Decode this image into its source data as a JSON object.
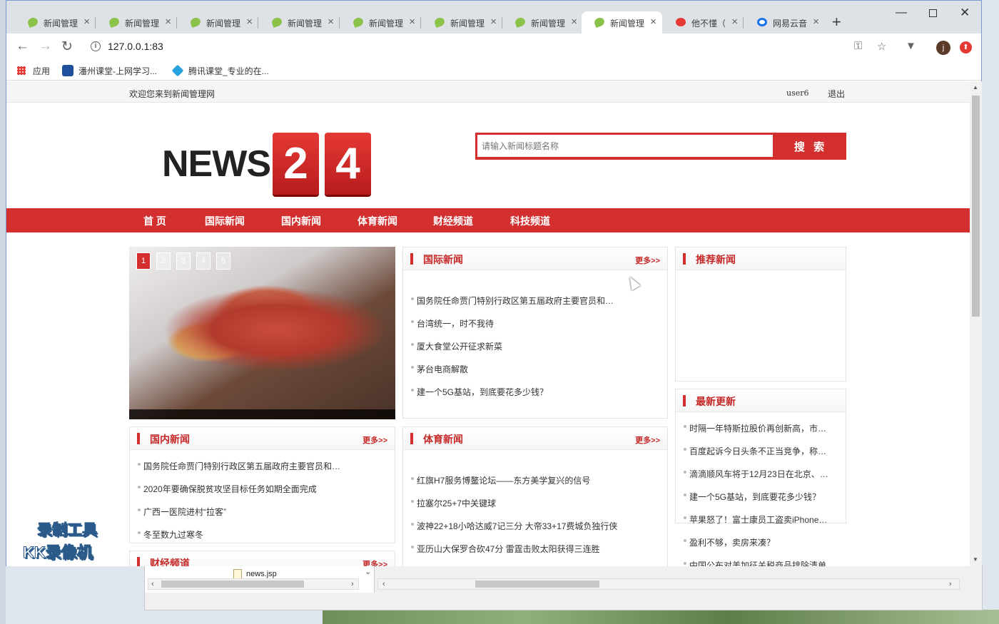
{
  "browser": {
    "tabs": [
      {
        "label": "新闻管理",
        "icon": "leaf-icon",
        "active": false
      },
      {
        "label": "新闻管理",
        "icon": "leaf-icon",
        "active": false
      },
      {
        "label": "新闻管理",
        "icon": "leaf-icon",
        "active": false
      },
      {
        "label": "新闻管理",
        "icon": "leaf-icon",
        "active": false
      },
      {
        "label": "新闻管理",
        "icon": "leaf-icon",
        "active": false
      },
      {
        "label": "新闻管理",
        "icon": "leaf-icon",
        "active": false
      },
      {
        "label": "新闻管理",
        "icon": "leaf-icon",
        "active": false
      },
      {
        "label": "新闻管理",
        "icon": "leaf-icon",
        "active": true
      },
      {
        "label": "他不懂（",
        "icon": "netease-music-icon",
        "active": false
      },
      {
        "label": "网易云音",
        "icon": "netease-icon",
        "active": false
      }
    ],
    "url": "127.0.0.1:83",
    "bookmarks": [
      {
        "label": "应用",
        "icon": "apps-grid-icon"
      },
      {
        "label": "潘州课堂-上网学习...",
        "icon": "bookmark-icon"
      },
      {
        "label": "腾讯课堂_专业的在...",
        "icon": "tencent-classroom-icon"
      }
    ],
    "avatar_letter": "j"
  },
  "page": {
    "welcome": "欢迎您来到新闻管理网",
    "username": "user6",
    "logout": "退出",
    "logo": {
      "word": "NEWS",
      "digit1": "2",
      "digit2": "4"
    },
    "search": {
      "placeholder": "请输入新闻标题名称",
      "button": "搜 索"
    },
    "nav": [
      "首 页",
      "国际新闻",
      "国内新闻",
      "体育新闻",
      "财经频道",
      "科技频道"
    ],
    "slider": {
      "dots": [
        "1",
        "2",
        "3",
        "4",
        "5"
      ],
      "active": 1
    },
    "sections": {
      "international": {
        "title": "国际新闻",
        "more": "更多>>",
        "items": [
          "国务院任命贾门特别行政区第五届政府主要官员和…",
          "台湾统一，时不我待",
          "厦大食堂公开征求新菜",
          "茅台电商解散",
          "建一个5G基站，到底要花多少钱？"
        ]
      },
      "recommended": {
        "title": "推荐新闻"
      },
      "latest": {
        "title": "最新更新",
        "items": [
          "时隔一年特斯拉股价再创新高，市…",
          "百度起诉今日头条不正当竞争，称…",
          "滴滴顺风车将于12月23日在北京、…",
          "建一个5G基站，到底要花多少钱？",
          "苹果怒了！富士康员工盗卖iPhone…",
          "盈利不够，卖房来凑？",
          "中国公布对美加征关税商品排除清单"
        ]
      },
      "domestic": {
        "title": "国内新闻",
        "more": "更多>>",
        "items": [
          "国务院任命贾门特别行政区第五届政府主要官员和…",
          "2020年要确保脱贫攻坚目标任务如期全面完成",
          "广西一医院进村“拉客”",
          "冬至数九过寒冬"
        ]
      },
      "sports": {
        "title": "体育新闻",
        "more": "更多>>",
        "items": [
          "红旗H7服务博鳌论坛——东方美学复兴的信号",
          "拉塞尔25+7中关键球",
          "波神22+18小哈达威7记三分 大帝33+17费城负独行侠",
          "亚历山大保罗合砍47分 雷霆击败太阳获得三连胜"
        ]
      },
      "finance": {
        "title": "财经频道",
        "more": "更多>>"
      }
    }
  },
  "ide": {
    "file": "news.jsp"
  },
  "watermark": {
    "line1": "录制工具",
    "line2": "KK录像机"
  }
}
